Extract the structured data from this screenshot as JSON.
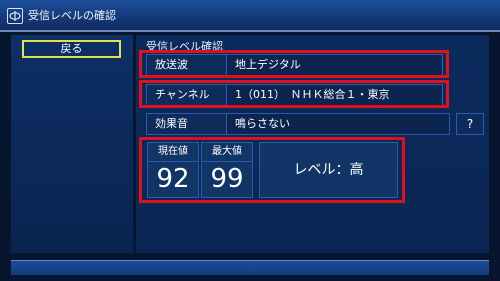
{
  "window": {
    "title": "受信レベルの確認",
    "logo_icon": "tv-icon"
  },
  "sidebar": {
    "back_label": "戻る"
  },
  "main": {
    "section_title": "受信レベル確認",
    "rows": [
      {
        "label": "放送波",
        "value": "地上デジタル"
      },
      {
        "label": "チャンネル",
        "value": "1（011）　ＮＨＫ総合１・東京"
      },
      {
        "label": "効果音",
        "value": "鳴らさない"
      }
    ],
    "help_label": "?",
    "current": {
      "label": "現在値",
      "value": "92"
    },
    "max": {
      "label": "最大値",
      "value": "99"
    },
    "level_text": "レベル：高"
  },
  "colors": {
    "highlight": "#e0101c",
    "focus": "#dbe44c",
    "panel": "#0b2a5d"
  }
}
